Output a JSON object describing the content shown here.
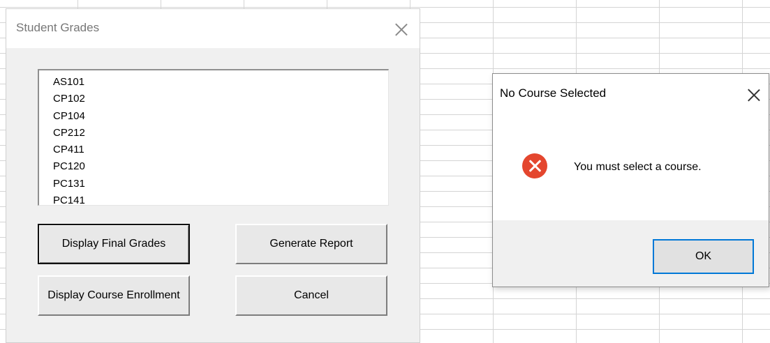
{
  "userform": {
    "title": "Student Grades",
    "courses": [
      "AS101",
      "CP102",
      "CP104",
      "CP212",
      "CP411",
      "PC120",
      "PC131",
      "PC141"
    ],
    "buttons": {
      "display_final_grades": "Display Final Grades",
      "generate_report": "Generate Report",
      "display_course_enrollment": "Display Course Enrollment",
      "cancel": "Cancel"
    },
    "close_icon": "close-icon"
  },
  "message_box": {
    "title": "No Course Selected",
    "message": "You must select a course.",
    "icon": "error-icon",
    "ok_label": "OK",
    "error_color": "#e4462e",
    "focus_color": "#0078d7"
  }
}
